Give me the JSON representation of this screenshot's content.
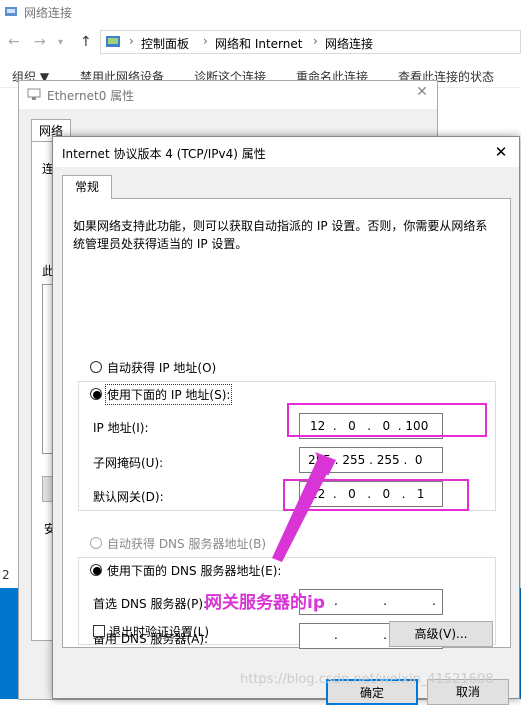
{
  "explorer": {
    "title": "网络连接",
    "breadcrumb": [
      "控制面板",
      "网络和 Internet",
      "网络连接"
    ],
    "commands": [
      "组织 ▼",
      "禁用此网络设备",
      "诊断这个连接",
      "重命名此连接",
      "查看此连接的状态"
    ],
    "side_numbers": [
      "2"
    ]
  },
  "ethernet_window": {
    "title": "Ethernet0 属性",
    "tab": "网络",
    "side_labels": [
      "连",
      "此",
      "安"
    ]
  },
  "dialog": {
    "title": "Internet 协议版本 4 (TCP/IPv4) 属性",
    "tab": "常规",
    "description": "如果网络支持此功能，则可以获取自动指派的 IP 设置。否则，你需要从网络系统管理员处获得适当的 IP 设置。",
    "auto_ip_label": "自动获得 IP 地址(O)",
    "manual_ip_label": "使用下面的 IP 地址(S):",
    "ip_label": "IP 地址(I):",
    "ip_value": [
      "12",
      "0",
      "0",
      "100"
    ],
    "mask_label": "子网掩码(U):",
    "mask_value": [
      "255",
      "255",
      "255",
      "0"
    ],
    "gateway_label": "默认网关(D):",
    "gateway_value": [
      "12",
      "0",
      "0",
      "1"
    ],
    "auto_dns_label": "自动获得 DNS 服务器地址(B)",
    "manual_dns_label": "使用下面的 DNS 服务器地址(E):",
    "preferred_dns_label": "首选 DNS 服务器(P):",
    "alternate_dns_label": "备用 DNS 服务器(A):",
    "validate_label": "退出时验证设置(L)",
    "advanced_button": "高级(V)...",
    "ok_button": "确定",
    "cancel_button": "取消"
  },
  "annotation": "网关服务器的ip",
  "watermark": "https://blog.csdn.net/weixin_41521608",
  "colors": {
    "highlight": "#e62ed6",
    "taskbar": "#0077cc"
  }
}
